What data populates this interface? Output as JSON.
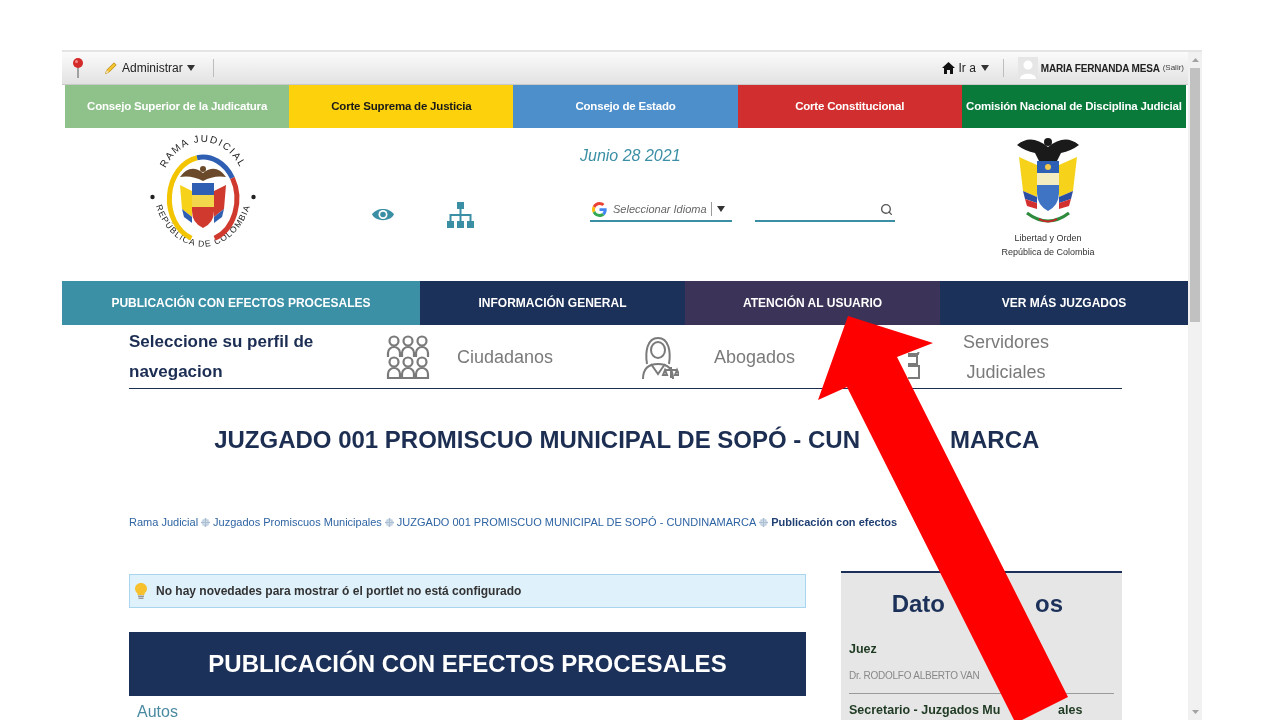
{
  "toolbar": {
    "menu_label": "Administrar",
    "goto_label": "Ir a",
    "user_name": "MARIA FERNANDA MESA",
    "logout_label": "(Salir)"
  },
  "institutions": [
    {
      "label": "Consejo Superior de la Judicatura",
      "color": "#8fc28b"
    },
    {
      "label": "Corte Suprema de Justicia",
      "color": "#fdd20d"
    },
    {
      "label": "Consejo de Estado",
      "color": "#4d8fcb"
    },
    {
      "label": "Corte Constitucional",
      "color": "#d12f2f"
    },
    {
      "label": "Comisión Nacional de Disciplina Judicial",
      "color": "#0a7a3b"
    }
  ],
  "header": {
    "seal": {
      "top_text": "RAMA JUDICIAL",
      "bottom_text": "REPÚBLICA DE COLOMBIA"
    },
    "date": "Junio 28 2021",
    "language_select": {
      "label": "Seleccionar Idioma"
    },
    "crest_caption": [
      "Libertad y Orden",
      "República de Colombia"
    ]
  },
  "nav": [
    {
      "label": "PUBLICACIÓN CON EFECTOS PROCESALES",
      "selected": true,
      "hovered": false
    },
    {
      "label": "INFORMACIÓN GENERAL",
      "selected": false,
      "hovered": false
    },
    {
      "label": "ATENCIÓN AL USUARIO",
      "selected": false,
      "hovered": true
    },
    {
      "label": "VER MÁS JUZGADOS",
      "selected": false,
      "hovered": false
    }
  ],
  "profile": {
    "prompt": "Seleccione su perfil de navegacion",
    "options": [
      {
        "kind": "citizens",
        "label": "Ciudadanos"
      },
      {
        "kind": "lawyers",
        "label": "Abogados"
      },
      {
        "kind": "servants",
        "label": "Servidores Judiciales"
      }
    ]
  },
  "page_title": {
    "visible_parts": [
      "JUZGADO 001 PROMISCUO MUNICIPAL DE SOPÓ - CUN",
      "MARCA"
    ]
  },
  "breadcrumb": [
    {
      "label": "Rama Judicial",
      "current": false
    },
    {
      "label": "Juzgados Promiscuos Municipales",
      "current": false
    },
    {
      "label": "JUZGADO 001 PROMISCUO MUNICIPAL DE SOPÓ - CUNDINAMARCA",
      "current": false
    },
    {
      "label": "Publicación con efectos",
      "current": true
    }
  ],
  "notice": {
    "text": "No hay novedades para mostrar ó el portlet no está configurado"
  },
  "section": {
    "heading": "PUBLICACIÓN CON EFECTOS PROCESALES",
    "links": [
      "Autos"
    ]
  },
  "info_panel": {
    "heading_parts": [
      "Dato",
      "os"
    ],
    "entries": [
      {
        "role_parts": [
          "Juez"
        ],
        "name": "Dr. RODOLFO ALBERTO VAN"
      },
      {
        "role_parts": [
          "Secretario - Juzgados Mu",
          "ales"
        ]
      }
    ]
  }
}
